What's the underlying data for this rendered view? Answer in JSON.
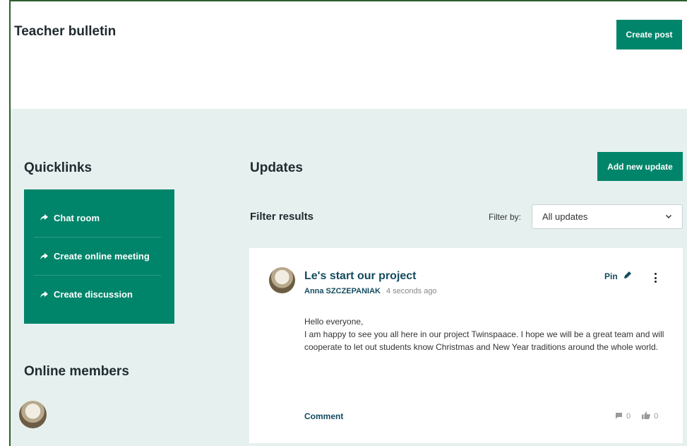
{
  "header": {
    "title": "Teacher bulletin",
    "create_post_label": "Create post"
  },
  "quicklinks": {
    "title": "Quicklinks",
    "items": [
      {
        "label": "Chat room",
        "icon": "share-arrow-icon"
      },
      {
        "label": "Create online meeting",
        "icon": "share-arrow-icon"
      },
      {
        "label": "Create discussion",
        "icon": "share-arrow-icon"
      }
    ]
  },
  "online_members": {
    "title": "Online members"
  },
  "updates": {
    "title": "Updates",
    "add_label": "Add new update",
    "filter_results_label": "Filter results",
    "filter_by_label": "Filter by:",
    "filter_value": "All updates"
  },
  "post": {
    "title": "Le's start our project",
    "author": "Anna SZCZEPANIAK",
    "time": "4 seconds ago",
    "pin_label": "Pin",
    "body_lines": [
      "Hello everyone,",
      "I am happy to see you all here in our project Twinspaace. I hope we will be a great team and will cooperate to let out students know Christmas and New Year traditions around the whole world."
    ],
    "comment_label": "Comment",
    "comments_count": "0",
    "likes_count": "0"
  },
  "colors": {
    "accent": "#00856a",
    "panel_bg": "#e6f1ef",
    "link": "#134b5f"
  }
}
